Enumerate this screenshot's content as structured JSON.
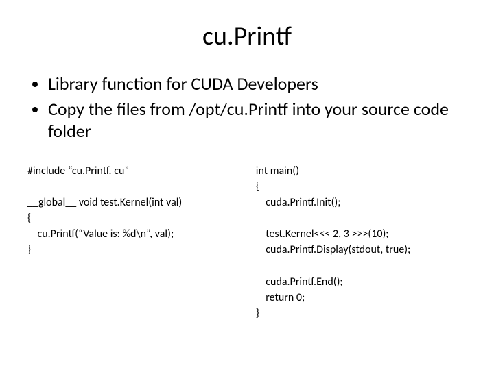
{
  "title": "cu.Printf",
  "bullets": [
    "Library function for CUDA Developers",
    "Copy the files from /opt/cu.Printf into your source code folder"
  ],
  "code_left": "#include “cu.Printf. cu”\n\n__global__ void test.Kernel(int val)\n{\n    cu.Printf(“Value is: %d\\n”, val);\n}",
  "code_right": "int main()\n{\n    cuda.Printf.Init();\n\n    test.Kernel<<< 2, 3 >>>(10);\n    cuda.Printf.Display(stdout, true);\n\n    cuda.Printf.End();\n    return 0;\n}"
}
